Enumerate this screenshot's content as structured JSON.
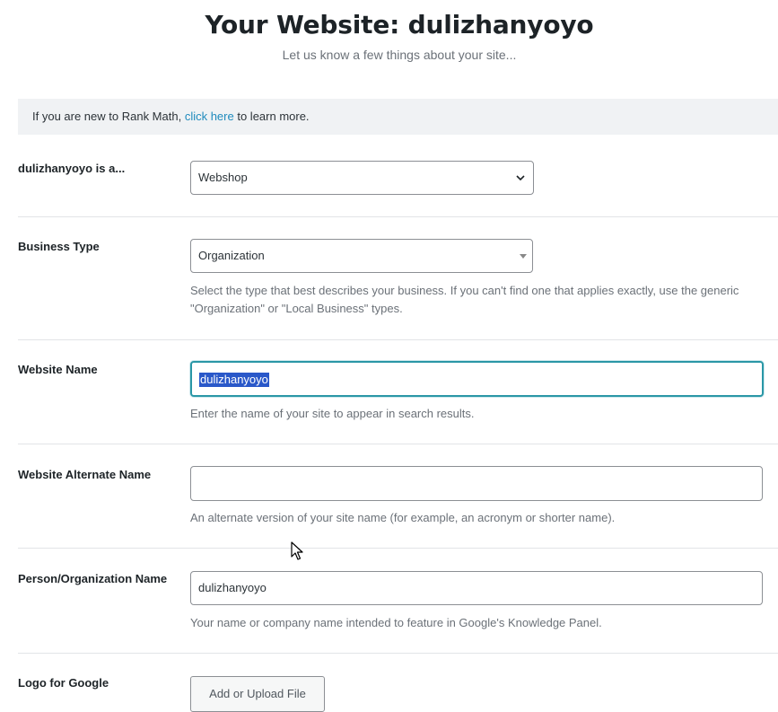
{
  "header": {
    "title": "Your Website: dulizhanyoyo",
    "subtitle": "Let us know a few things about your site..."
  },
  "notice": {
    "prefix": "If you are new to Rank Math, ",
    "link": "click here",
    "suffix": " to learn more."
  },
  "site_type": {
    "label": "dulizhanyoyo is a...",
    "value": "Webshop",
    "icon": "chevron-down-icon"
  },
  "business_type": {
    "label": "Business Type",
    "value": "Organization",
    "help": "Select the type that best describes your business. If you can't find one that applies exactly, use the generic \"Organization\" or \"Local Business\" types."
  },
  "website_name": {
    "label": "Website Name",
    "value": "dulizhanyoyo",
    "help": "Enter the name of your site to appear in search results."
  },
  "alternate_name": {
    "label": "Website Alternate Name",
    "value": "",
    "help": "An alternate version of your site name (for example, an acronym or shorter name)."
  },
  "org_name": {
    "label": "Person/Organization Name",
    "value": "dulizhanyoyo",
    "help": "Your name or company name intended to feature in Google's Knowledge Panel."
  },
  "logo": {
    "label": "Logo for Google",
    "button": "Add or Upload File"
  },
  "colors": {
    "link": "#1f8bbd",
    "focus_border": "#2a97a6",
    "selection": "#2a58c9"
  }
}
